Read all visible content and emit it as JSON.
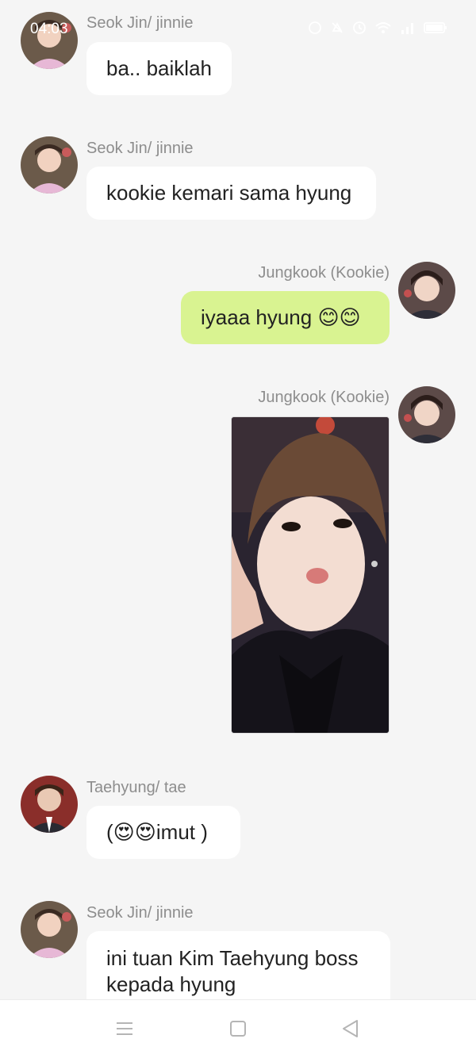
{
  "status_bar": {
    "time": "04:03",
    "icons": [
      "alarm-icon",
      "mute-icon",
      "clock-icon",
      "wifi-icon",
      "signal-icon",
      "battery-icon"
    ]
  },
  "messages": [
    {
      "id": 1,
      "side": "left",
      "sender": "Seok Jin/ jinnie",
      "avatar": "seokjin-avatar",
      "text": "ba.. baiklah"
    },
    {
      "id": 2,
      "side": "left",
      "sender": "Seok Jin/ jinnie",
      "avatar": "seokjin-avatar",
      "text": "kookie kemari sama hyung"
    },
    {
      "id": 3,
      "side": "right",
      "sender": "Jungkook (Kookie)",
      "avatar": "jungkook-avatar",
      "text": "iyaaa hyung ",
      "emoji": "😊😊"
    },
    {
      "id": 4,
      "side": "right",
      "sender": "Jungkook (Kookie)",
      "avatar": "jungkook-avatar",
      "type": "photo"
    },
    {
      "id": 5,
      "side": "left",
      "sender": "Taehyung/ tae",
      "avatar": "taehyung-avatar",
      "text_prefix": "(",
      "emoji": "😍😍",
      "text": "imut )"
    },
    {
      "id": 6,
      "side": "left",
      "sender": "Seok Jin/ jinnie",
      "avatar": "seokjin-avatar",
      "text_line1": "ini tuan Kim Taehyung boss",
      "text_line2": "kepada hyung"
    }
  ],
  "nav_bar": {
    "buttons": [
      "menu-icon",
      "home-square-icon",
      "back-triangle-icon"
    ]
  },
  "colors": {
    "background": "#f5f5f5",
    "bubble_left": "#ffffff",
    "bubble_right": "#d9f391",
    "sender_name": "#8d8d8d"
  }
}
